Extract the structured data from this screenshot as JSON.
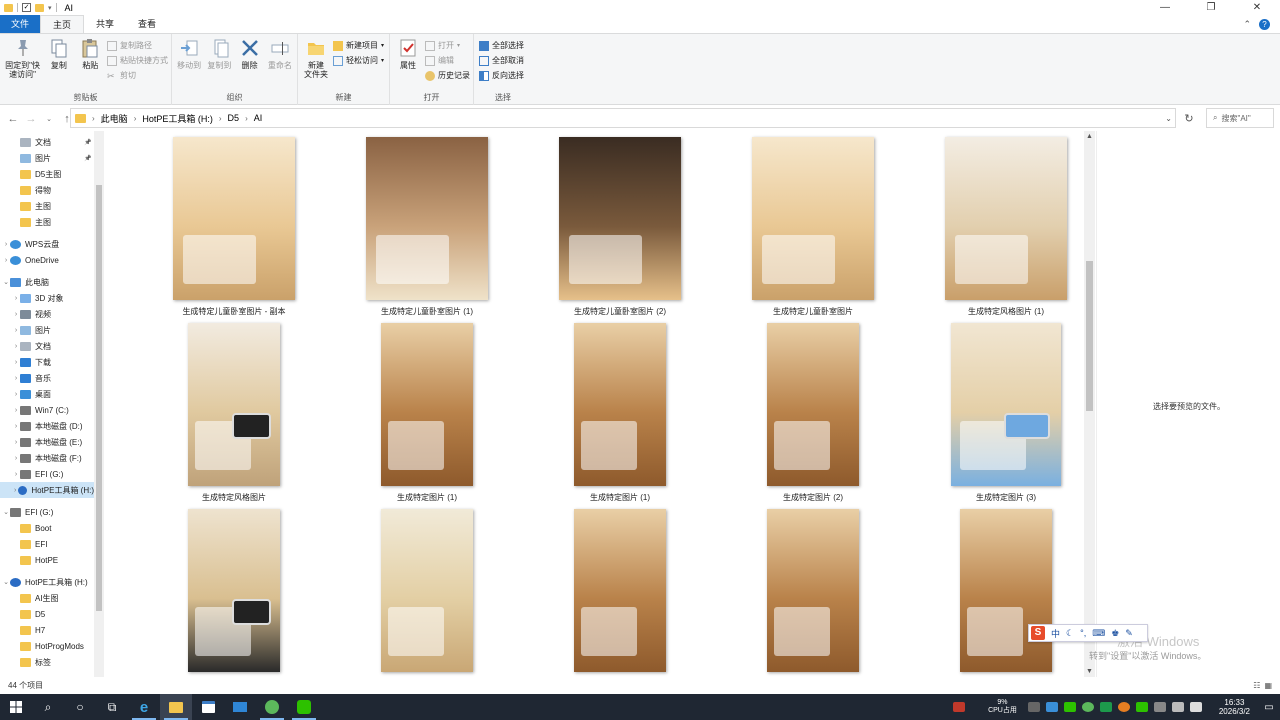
{
  "window": {
    "title": "AI",
    "controls": [
      "—",
      "❐",
      "✕"
    ]
  },
  "ribbon_tabs": [
    {
      "label": "文件"
    },
    {
      "label": "主页"
    },
    {
      "label": "共享"
    },
    {
      "label": "查看"
    }
  ],
  "ribbon": {
    "clipboard": {
      "label": "剪贴板",
      "pin": "固定到\"快速访问\"",
      "copy": "复制",
      "paste": "粘贴",
      "copy_path": "复制路径",
      "paste_shortcut": "粘贴快捷方式",
      "cut": "剪切"
    },
    "organize": {
      "label": "组织",
      "move_to": "移动到",
      "copy_to": "复制到",
      "delete": "删除",
      "rename": "重命名"
    },
    "new": {
      "label": "新建",
      "new_folder": "新建\n文件夹",
      "new_item": "新建项目",
      "easy_access": "轻松访问"
    },
    "open": {
      "label": "打开",
      "properties": "属性",
      "open": "打开",
      "edit": "编辑",
      "history": "历史记录"
    },
    "select": {
      "label": "选择",
      "select_all": "全部选择",
      "select_none": "全部取消",
      "invert": "反向选择"
    }
  },
  "address": {
    "crumbs": [
      "此电脑",
      "HotPE工具箱 (H:)",
      "D5",
      "AI"
    ],
    "search_placeholder": "搜索\"AI\""
  },
  "nav": [
    {
      "label": "文档",
      "type": "doc",
      "indent": 2,
      "pinned": true
    },
    {
      "label": "图片",
      "type": "pic",
      "indent": 2,
      "pinned": true
    },
    {
      "label": "D5主图",
      "type": "folder",
      "indent": 2
    },
    {
      "label": "得物",
      "type": "folder",
      "indent": 2
    },
    {
      "label": "主图",
      "type": "folder",
      "indent": 2
    },
    {
      "label": "主图",
      "type": "folder",
      "indent": 2
    },
    {
      "label": "WPS云盘",
      "type": "cloud",
      "indent": 1,
      "arrow": "›"
    },
    {
      "label": "OneDrive",
      "type": "cloud",
      "indent": 1,
      "arrow": "›"
    },
    {
      "label": "此电脑",
      "type": "pc",
      "indent": 1,
      "arrow": "⌄"
    },
    {
      "label": "3D 对象",
      "type": "obj3d",
      "indent": 2,
      "arrow": "›"
    },
    {
      "label": "视频",
      "type": "video",
      "indent": 2,
      "arrow": "›"
    },
    {
      "label": "图片",
      "type": "pic",
      "indent": 2,
      "arrow": "›"
    },
    {
      "label": "文档",
      "type": "doc",
      "indent": 2,
      "arrow": "›"
    },
    {
      "label": "下载",
      "type": "download",
      "indent": 2,
      "arrow": "›"
    },
    {
      "label": "音乐",
      "type": "music",
      "indent": 2,
      "arrow": "›"
    },
    {
      "label": "桌面",
      "type": "desktop",
      "indent": 2,
      "arrow": "›"
    },
    {
      "label": "Win7 (C:)",
      "type": "drive",
      "indent": 2,
      "arrow": "›"
    },
    {
      "label": "本地磁盘 (D:)",
      "type": "drive",
      "indent": 2,
      "arrow": "›"
    },
    {
      "label": "本地磁盘 (E:)",
      "type": "drive",
      "indent": 2,
      "arrow": "›"
    },
    {
      "label": "本地磁盘 (F:)",
      "type": "drive",
      "indent": 2,
      "arrow": "›"
    },
    {
      "label": "EFI (G:)",
      "type": "drive",
      "indent": 2,
      "arrow": "›"
    },
    {
      "label": "HotPE工具箱 (H:)",
      "type": "hotpe",
      "indent": 2,
      "arrow": "›",
      "selected": true
    },
    {
      "label": "EFI (G:)",
      "type": "drive",
      "indent": 1,
      "arrow": "⌄"
    },
    {
      "label": "Boot",
      "type": "folder",
      "indent": 2
    },
    {
      "label": "EFI",
      "type": "folder",
      "indent": 2
    },
    {
      "label": "HotPE",
      "type": "folder",
      "indent": 2
    },
    {
      "label": "HotPE工具箱 (H:)",
      "type": "hotpe",
      "indent": 1,
      "arrow": "⌄"
    },
    {
      "label": "AI生图",
      "type": "folder",
      "indent": 2
    },
    {
      "label": "D5",
      "type": "folder",
      "indent": 2
    },
    {
      "label": "H7",
      "type": "folder",
      "indent": 2
    },
    {
      "label": "HotProgMods",
      "type": "folder",
      "indent": 2
    },
    {
      "label": "标签",
      "type": "folder",
      "indent": 2
    }
  ],
  "files": [
    {
      "name": "生成特定儿童卧室图片 - 副本",
      "kind": "kid-wake",
      "shape": "portrait"
    },
    {
      "name": "生成特定儿童卧室图片 (1)",
      "kind": "kid-study",
      "shape": "portrait"
    },
    {
      "name": "生成特定儿童卧室图片 (2)",
      "kind": "kid-sleep-dark",
      "shape": "portrait"
    },
    {
      "name": "生成特定儿童卧室图片",
      "kind": "kid-wake",
      "shape": "portrait"
    },
    {
      "name": "生成特定风格图片 (1)",
      "kind": "kid-sleep-light",
      "shape": "portrait"
    },
    {
      "name": "生成特定风格图片",
      "kind": "kid-clock",
      "shape": "tall"
    },
    {
      "name": "生成特定图片 (1)",
      "kind": "bed-warm",
      "shape": "tall"
    },
    {
      "name": "生成特定图片 (1)",
      "kind": "bed-warm",
      "shape": "tall"
    },
    {
      "name": "生成特定图片 (2)",
      "kind": "bed-warm",
      "shape": "tall"
    },
    {
      "name": "生成特定图片 (3)",
      "kind": "blue-clock",
      "shape": "portrait"
    },
    {
      "name": "",
      "kind": "black-clock",
      "shape": "tall"
    },
    {
      "name": "",
      "kind": "bed-light",
      "shape": "tall"
    },
    {
      "name": "",
      "kind": "bed-warm",
      "shape": "tall"
    },
    {
      "name": "",
      "kind": "bed-warm",
      "shape": "tall"
    },
    {
      "name": "",
      "kind": "bed-warm",
      "shape": "tall"
    }
  ],
  "preview": {
    "message": "选择要预览的文件。",
    "watermark_title": "激活 Windows",
    "watermark_sub": "转到\"设置\"以激活 Windows。"
  },
  "ime": {
    "lang": "中",
    "logo": "S"
  },
  "status": {
    "count": "44 个项目"
  },
  "taskbar": {
    "cpu_pct": "9%",
    "cpu_label": "CPU占用",
    "time": "16:33",
    "date": "2026/3/2"
  }
}
